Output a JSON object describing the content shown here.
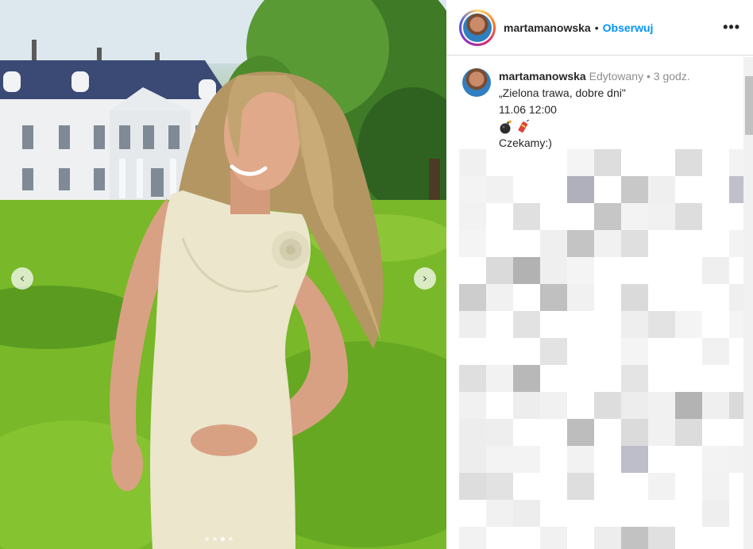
{
  "post": {
    "username": "martamanowska",
    "separator": "•",
    "follow_label": "Obserwuj",
    "more_label": "•••"
  },
  "caption": {
    "username": "martamanowska",
    "edited_label": "Edytowany",
    "dot": "•",
    "time": "3 godz.",
    "line1": "„Zielona trawa, dobre dni\"",
    "line2": "11.06 12:00",
    "line4": "Czekamy:)"
  },
  "carousel": {
    "prev_icon": "‹",
    "next_icon": "›",
    "slide_count": 4,
    "active_slide": 3
  },
  "icons": {
    "bomb": "bomb-emoji",
    "firecracker": "firecracker-emoji"
  },
  "colors": {
    "follow": "#0095f6",
    "text": "#262626",
    "meta": "#8e8e8e"
  }
}
